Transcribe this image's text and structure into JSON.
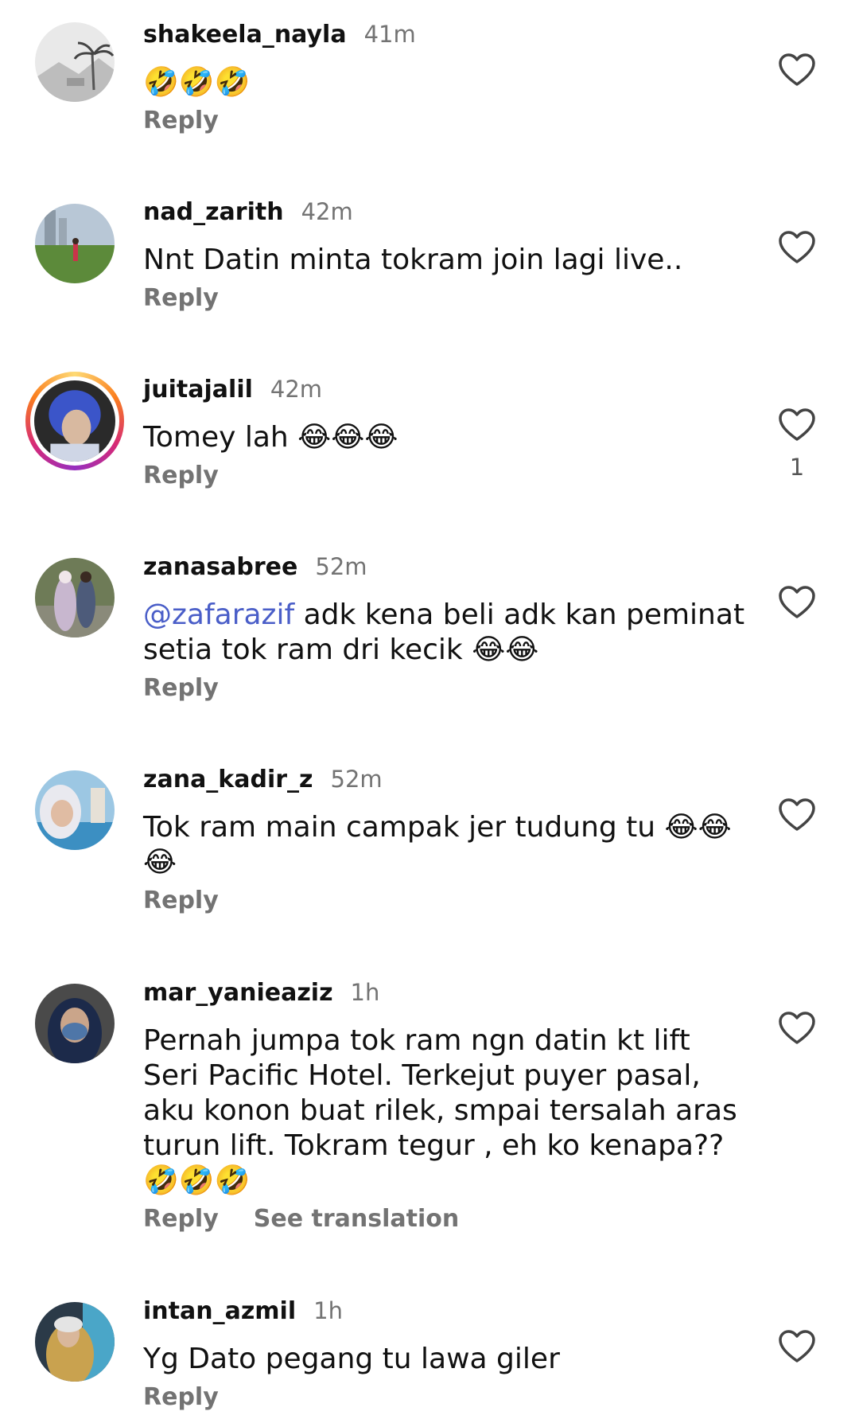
{
  "comments": [
    {
      "username": "shakeela_nayla",
      "time": "41m",
      "text": "🤣🤣🤣",
      "reply_label": "Reply"
    },
    {
      "username": "nad_zarith",
      "time": "42m",
      "text": "Nnt Datin minta tokram join lagi live..",
      "reply_label": "Reply"
    },
    {
      "username": "juitajalil",
      "time": "42m",
      "text": "Tomey lah 😂😂😂",
      "reply_label": "Reply",
      "like_count": "1"
    },
    {
      "username": "zanasabree",
      "time": "52m",
      "mention": "@zafarazif",
      "text": " adk kena beli adk kan peminat setia tok ram dri kecik 😂😂",
      "reply_label": "Reply"
    },
    {
      "username": "zana_kadir_z",
      "time": "52m",
      "text": "Tok ram main campak jer tudung tu 😂😂 😂",
      "reply_label": "Reply"
    },
    {
      "username": "mar_yanieaziz",
      "time": "1h",
      "text": "Pernah jumpa tok ram ngn datin kt lift Seri Pacific Hotel. Terkejut puyer pasal, aku konon buat rilek, smpai tersalah aras turun lift. Tokram tegur , eh ko kenapa?? 🤣🤣🤣",
      "reply_label": "Reply",
      "translation_label": "See translation"
    },
    {
      "username": "intan_azmil",
      "time": "1h",
      "text": "Yg Dato pegang tu lawa giler",
      "reply_label": "Reply"
    }
  ],
  "colors": {
    "meta_gray": "#737373",
    "mention_blue": "#4a5ec8",
    "text": "#111111"
  }
}
